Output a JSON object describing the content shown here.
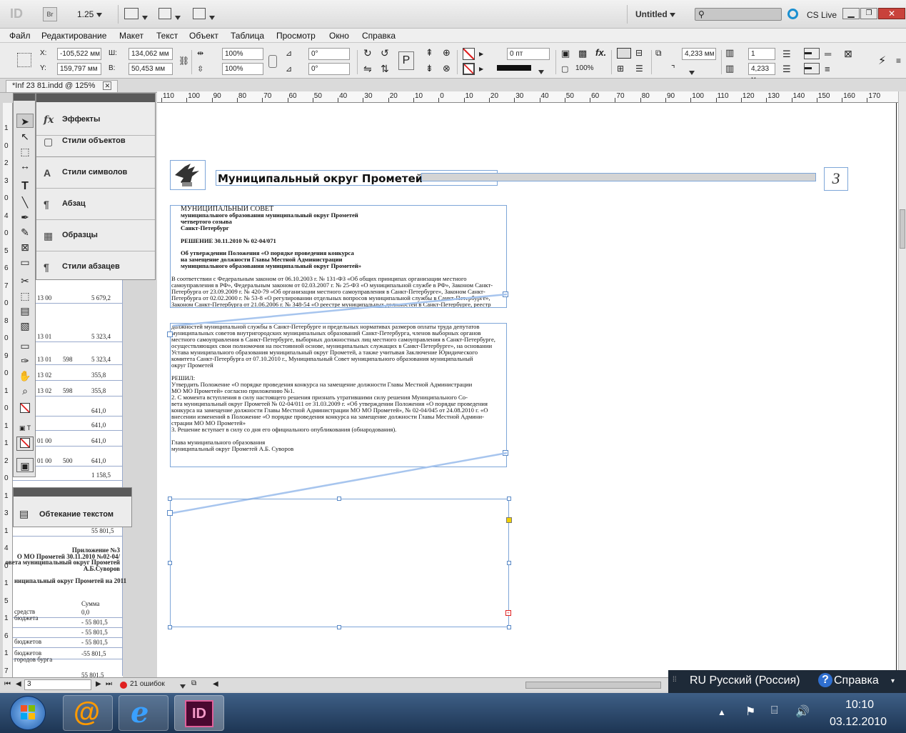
{
  "app": {
    "logo": "ID",
    "bridge": "Br",
    "zoom": "1.25",
    "workspace": "Untitled",
    "cs_live": "CS Live"
  },
  "menu": [
    "Файл",
    "Редактирование",
    "Макет",
    "Текст",
    "Объект",
    "Таблица",
    "Просмотр",
    "Окно",
    "Справка"
  ],
  "control": {
    "x_label": "X:",
    "x": "-105,522 мм",
    "y_label": "Y:",
    "y": "159,797 мм",
    "w_label": "Ш:",
    "w": "134,062 мм",
    "h_label": "В:",
    "h": "50,453 мм",
    "scale_x": "100%",
    "scale_y": "100%",
    "rot": "0°",
    "shear": "0°",
    "stroke_weight": "0 пт",
    "opacity": "100%",
    "fit_w": "4,233 мм",
    "columns": "1",
    "gutter": "4,233 м"
  },
  "document_tab": "*Inf 23 81.indd @ 125%",
  "ruler_numbers": [
    "110",
    "100",
    "90",
    "80",
    "70",
    "60",
    "50",
    "40",
    "30",
    "20",
    "10",
    "0",
    "10",
    "20",
    "30",
    "40",
    "50",
    "60",
    "70",
    "80",
    "90",
    "100",
    "110",
    "120",
    "130",
    "140",
    "150",
    "160",
    "170"
  ],
  "left_ruler": [
    "1",
    "0",
    "2",
    "3",
    "0",
    "4",
    "0",
    "5",
    "6",
    "7",
    "0",
    "8",
    "0",
    "9",
    "0",
    "1",
    "0",
    "1",
    "1",
    "2",
    "0",
    "1",
    "3",
    "1",
    "4",
    "0",
    "1",
    "5",
    "1",
    "6",
    "1",
    "7"
  ],
  "panels": {
    "items": [
      {
        "icon": "fx",
        "label": "Эффекты"
      },
      {
        "icon": "▢",
        "label": "Стили объектов"
      },
      {
        "icon": "A",
        "label": "Стили символов"
      },
      {
        "icon": "¶",
        "label": "Абзац"
      },
      {
        "icon": "▦",
        "label": "Образцы"
      },
      {
        "icon": "¶",
        "label": "Стили абзацев"
      }
    ],
    "wrap_label": "Обтекание текстом"
  },
  "pasteboard": {
    "rows": [
      {
        "a": "13 00",
        "b": "",
        "c": "5 679,2"
      },
      {
        "a": "13 01",
        "b": "",
        "c": "5 323,4"
      },
      {
        "a": "13 01",
        "b": "598",
        "c": "5 323,4"
      },
      {
        "a": "13 02",
        "b": "",
        "c": "355,8"
      },
      {
        "a": "13 02",
        "b": "598",
        "c": "355,8"
      },
      {
        "a": "",
        "b": "",
        "c": "641,0"
      },
      {
        "a": "",
        "b": "",
        "c": "641,0"
      },
      {
        "a": "01 00",
        "b": "",
        "c": "641,0"
      },
      {
        "a": "01 00",
        "b": "500",
        "c": "641,0"
      },
      {
        "a": "",
        "b": "",
        "c": "1 158,5"
      },
      {
        "a": "",
        "b": "",
        "c": "55 801,5"
      }
    ],
    "appendix": [
      "Приложение №3",
      "О МО Прометей 30.11.2010 №02-04/",
      "овета муниципальный округ Прометей",
      "А.Б.Суворов"
    ],
    "subtitle": "ниципальный округ Прометей на 2011",
    "sum_header": "Сумма",
    "sum_rows": [
      {
        "a": "средств бюджета",
        "c": "0,0"
      },
      {
        "a": "",
        "c": "- 55 801,5"
      },
      {
        "a": "",
        "c": "- 55 801,5"
      },
      {
        "a": "бюджетов",
        "c": "- 55 801,5"
      },
      {
        "a": "бюджетов городов бурга",
        "c": "-55 801,5"
      },
      {
        "a": "",
        "c": "55 801,5"
      }
    ]
  },
  "page": {
    "header_title": "Муниципальный округ Прометей",
    "page_number": "3",
    "block1": [
      "МУНИЦИПАЛЬНЫЙ СОВЕТ",
      "муниципального образования муниципальный округ Прометей",
      "четвертого  созыва",
      "Санкт-Петербург",
      "",
      "РЕШЕНИЕ  30.11.2010 № 02-04/071",
      "",
      "Об утверждении Положения «О порядке проведения конкурса",
      "на замещение должности Главы Местной Администрации",
      "муниципального образования муниципальный округ  Прометей»",
      "",
      "                В соответствии с Федеральным законом  от 06.10.2003 г. № 131-ФЗ «Об общих принципах организации местного",
      "самоуправления в РФ», Федеральным законом от 02.03.2007 г. № 25-ФЗ «О муниципальной службе в РФ», Законом Санкт-",
      "Петербурга от 23.09.2009 г. № 420-79 «Об организации местного самоуправления в Санкт-Петербурге», Законом Санкт-",
      "Петербурга от 02.02.2000 г. № 53-8 «О регулировании отдельных вопросов муниципальной службы в Санкт-Петербурге»,",
      "Законом Санкт-Петербурга от 21.06.2006 г. № 348-54 «О реестре муниципальных должностей в Санкт-Петербурге, реестр"
    ],
    "block2": [
      "должностей муниципальной службы в Санкт-Петербурге и предельных  нормативах размеров оплаты труда депутатов",
      "муниципальных советов внутригородских муниципальных образований Санкт-Петербурга, членов выборных органов",
      "местного самоуправления в Санкт-Петербурге, выборных должностных лиц местного самоуправления в Санкт-Петербурге,",
      "осуществляющих свои полномочия на постоянной основе, муниципальных служащих в Санкт-Петербурге», на основании",
      "Устава муниципального образования муниципальный округ Прометей, а также учитывая Заключение Юридического",
      "комитета Санкт-Петербурга от 07.10.2010 г.,  Муниципальный Совет муниципального образования муниципальный",
      "округ Прометей",
      "",
      "    РЕШИЛ:",
      "    Утвердить Положение «О порядке проведения конкурса на замещение должности Главы Местной Администрации",
      "МО МО Прометей» согласно приложению №1.",
      "    2. С момента вступления в силу настоящего решения признать утратившими силу решения Муниципального Со-",
      "вета муниципальный округ Прометей № 02-04/011 от 31.03.2009 г. «Об утверждении Положения «О порядке проведения",
      "конкурса на замещение должности Главы Местной Администрации МО МО Прометей», № 02-04/045 от 24.08.2010 г. «О",
      "внесении изменений в Положение «О порядке проведения конкурса на замещение должности Главы Местной Админи-",
      "страции МО МО Прометей»",
      "    3. Решение вступает в силу со дня его официального опубликования (обнародования).",
      "",
      "    Глава муниципального образования",
      "    муниципальный округ Прометей  А.Б. Суворов"
    ]
  },
  "status": {
    "page": "3",
    "errors": "21 ошибок"
  },
  "langbar": {
    "lang": "RU Русский (Россия)",
    "help": "Справка"
  },
  "clock": {
    "time": "10:10",
    "date": "03.12.2010"
  },
  "colors": {
    "frame": "#7ea6d8",
    "taskbar": "#2b4468",
    "error": "#e02020"
  }
}
